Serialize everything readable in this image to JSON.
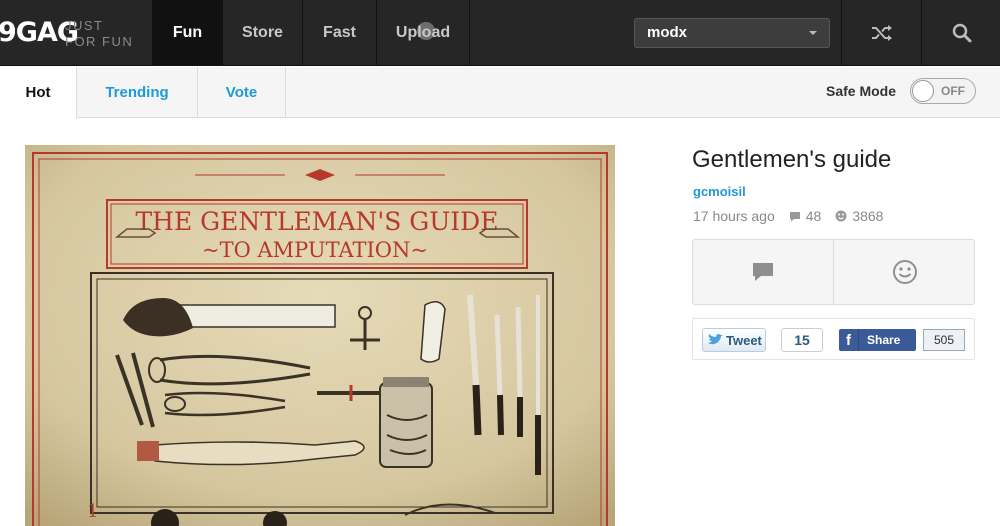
{
  "header": {
    "logo_mark": "9GAG",
    "logo_tagline_1": "JUST",
    "logo_tagline_2": "FOR FUN",
    "nav": [
      "Fun",
      "Store",
      "Fast",
      "Upload"
    ],
    "user": "modx",
    "icons": [
      "shuffle-icon",
      "search-icon",
      "upload-icon",
      "chevron-down-icon"
    ]
  },
  "subnav": {
    "tabs": [
      "Hot",
      "Trending",
      "Vote"
    ],
    "active_tab": "Hot",
    "safe_mode_label": "Safe Mode",
    "safe_mode_state": "OFF"
  },
  "post": {
    "title": "Gentlemen's guide",
    "image_text_1": "THE GENTLEMAN'S GUIDE",
    "image_text_2": "~TO AMPUTATION~",
    "author": "gcmoisil",
    "time": "17 hours ago",
    "comments": "48",
    "points": "3868"
  },
  "share": {
    "tweet_label": "Tweet",
    "tweet_count": "15",
    "fb_label": "Share",
    "fb_count": "505"
  },
  "colors": {
    "topbar": "#262626",
    "link_blue": "#1e9ad6",
    "facebook": "#3b5a98",
    "poster_bg": "#d8cba6",
    "poster_red": "#b53a2c"
  }
}
